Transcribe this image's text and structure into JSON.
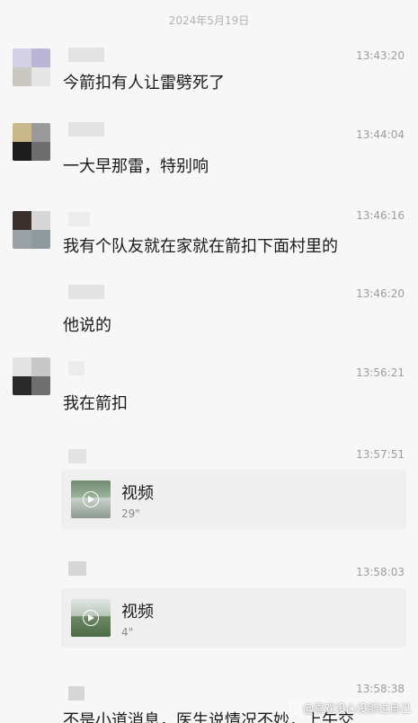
{
  "date_header": "2024年5月19日",
  "messages": [
    {
      "time": "13:43:20",
      "text": "今箭扣有人让雷劈死了"
    },
    {
      "time": "13:44:04",
      "text": "一大早那雷，特别响"
    },
    {
      "time": "13:46:16",
      "text": "我有个队友就在家就在箭扣下面村里的"
    },
    {
      "time": "13:46:20",
      "text": "他说的"
    },
    {
      "time": "13:56:21",
      "text": "我在箭扣"
    },
    {
      "time": "13:57:51",
      "video": {
        "label": "视频",
        "duration": "29\""
      }
    },
    {
      "time": "13:58:03",
      "video": {
        "label": "视频",
        "duration": "4\""
      }
    },
    {
      "time": "13:58:38",
      "text": "不是小道消息，医生说情况不妙，上午交"
    }
  ],
  "watermark": "@喜欢没心没肺过自己",
  "colors": {
    "background": "#f7f7f7",
    "bubble": "#efefef",
    "timestamp": "#9d9d9d",
    "text": "#1a1a1a"
  }
}
